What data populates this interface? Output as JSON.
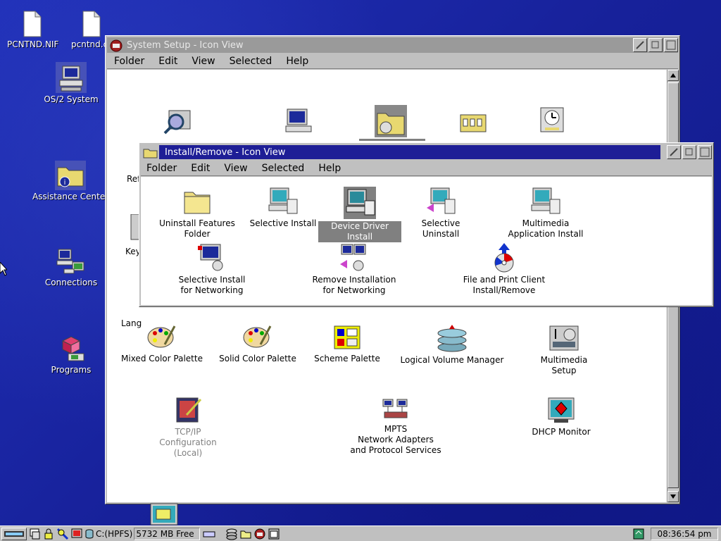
{
  "desktop": {
    "icons": [
      {
        "label": "PCNTND.NIF"
      },
      {
        "label": "pcntnd.c"
      },
      {
        "label": "OS/2 System"
      },
      {
        "label": "Assistance Center"
      },
      {
        "label": "Connections"
      },
      {
        "label": "Programs"
      }
    ]
  },
  "system_setup": {
    "title": "System Setup - Icon View",
    "menu": [
      "Folder",
      "Edit",
      "View",
      "Selected",
      "Help"
    ],
    "partial_labels": [
      "Ref",
      "Key",
      "Lang"
    ],
    "objects": [
      {
        "label": "Mixed Color Palette"
      },
      {
        "label": "Solid Color Palette"
      },
      {
        "label": "Scheme Palette"
      },
      {
        "label": "Logical Volume Manager"
      },
      {
        "label": "Multimedia\nSetup"
      },
      {
        "label": "TCP/IP\nConfiguration\n(Local)"
      },
      {
        "label": "MPTS\nNetwork Adapters\nand Protocol Services"
      },
      {
        "label": "DHCP Monitor"
      }
    ]
  },
  "install_remove": {
    "title": "Install/Remove - Icon View",
    "menu": [
      "Folder",
      "Edit",
      "View",
      "Selected",
      "Help"
    ],
    "objects": [
      {
        "label": "Uninstall Features Folder"
      },
      {
        "label": "Selective Install"
      },
      {
        "label": "Device Driver Install",
        "selected": true
      },
      {
        "label": "Selective Uninstall"
      },
      {
        "label": "Multimedia\nApplication Install"
      },
      {
        "label": "Selective Install\nfor Networking"
      },
      {
        "label": "Remove Installation\nfor Networking"
      },
      {
        "label": "File and Print Client\nInstall/Remove"
      }
    ]
  },
  "taskbar": {
    "drive": "C:(HPFS)",
    "free_space": "5732 MB Free",
    "clock": "08:36:54 pm"
  },
  "colors": {
    "desktop": "#1a26a8",
    "active_title": "#1e1e96",
    "inactive_title": "#9a9a9a",
    "selection": "#808080"
  }
}
